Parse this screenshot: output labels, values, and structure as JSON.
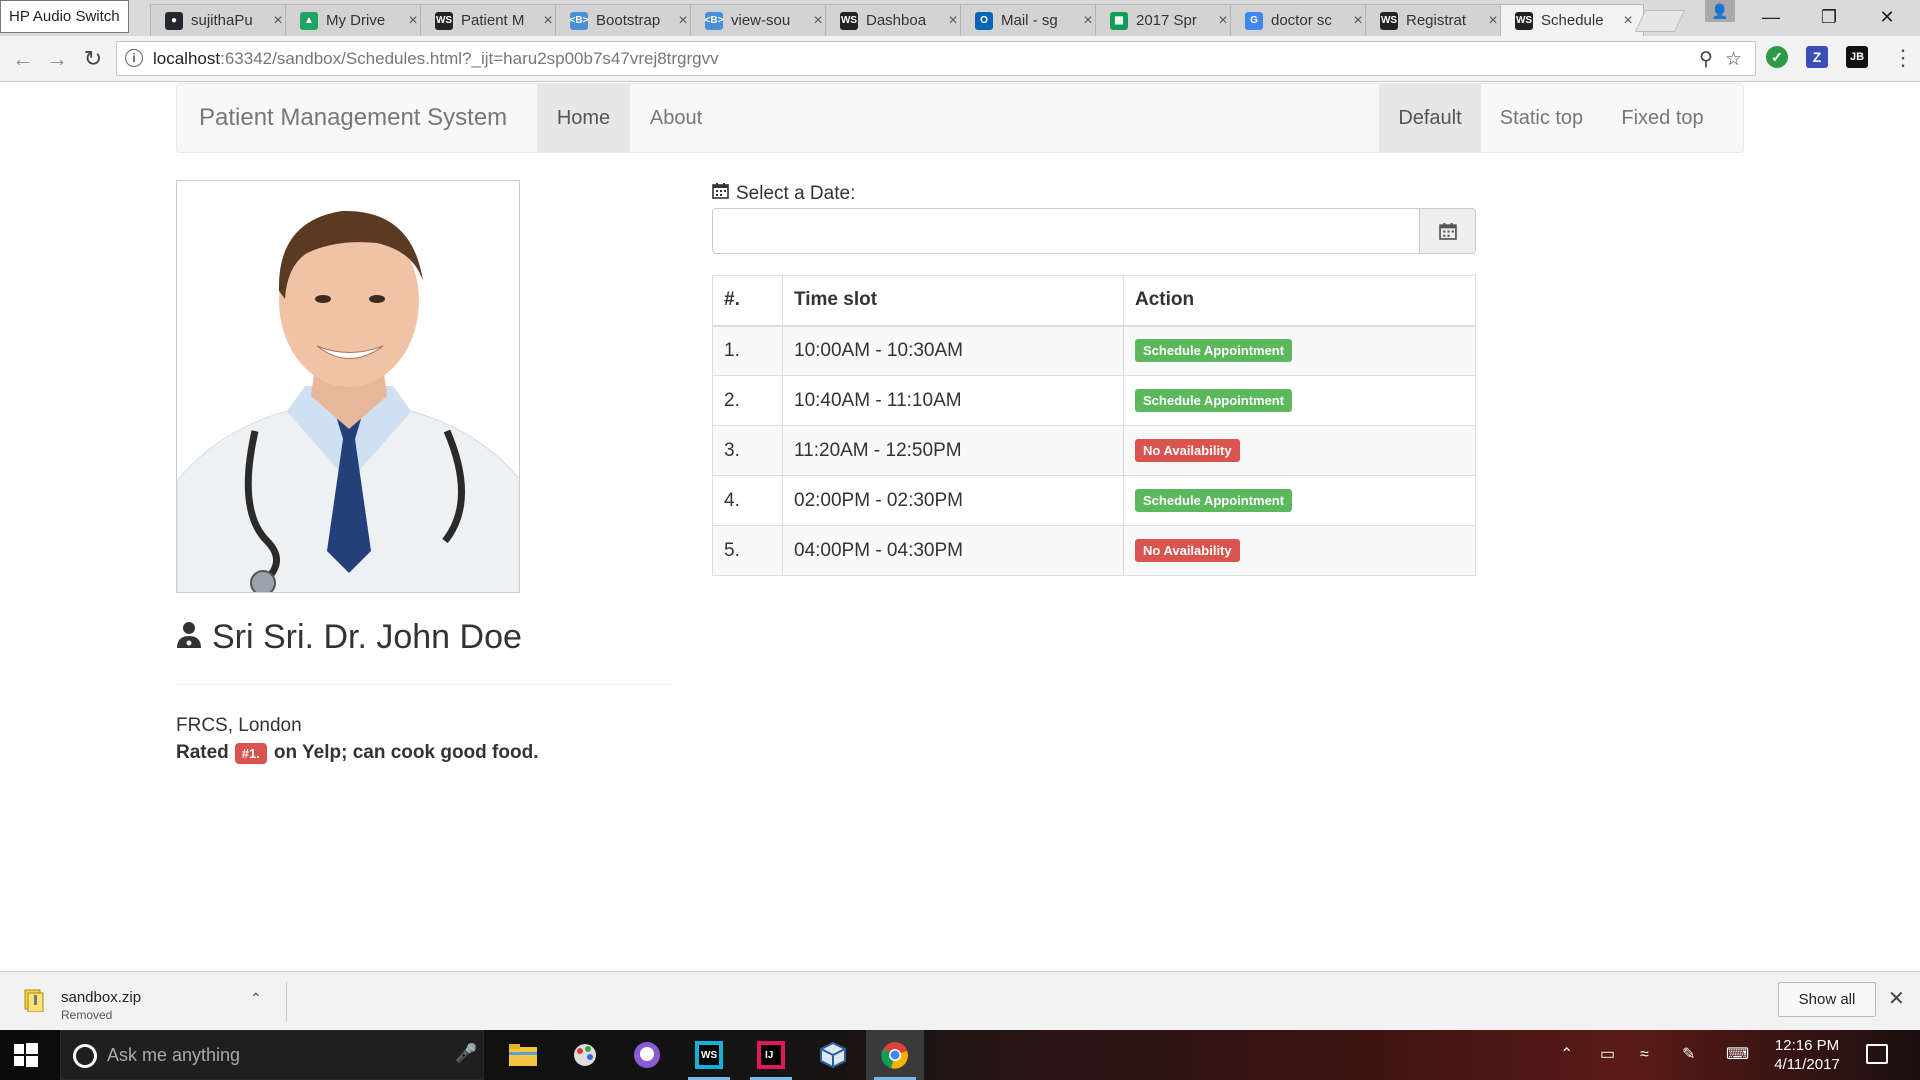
{
  "browser": {
    "tooltip": "HP Audio Switch",
    "tabs": [
      {
        "label": "sujithaPu",
        "icon": "github-icon"
      },
      {
        "label": "My Drive",
        "icon": "google-drive-icon"
      },
      {
        "label": "Patient M",
        "icon": "webstorm-icon"
      },
      {
        "label": "Bootstrap",
        "icon": "bootstrap-icon"
      },
      {
        "label": "view-sou",
        "icon": "bootstrap-icon"
      },
      {
        "label": "Dashboa",
        "icon": "webstorm-icon"
      },
      {
        "label": "Mail - sg",
        "icon": "outlook-icon"
      },
      {
        "label": "2017 Spr",
        "icon": "sheets-icon"
      },
      {
        "label": "doctor sc",
        "icon": "google-icon"
      },
      {
        "label": "Registrat",
        "icon": "webstorm-icon"
      },
      {
        "label": "Schedule",
        "icon": "webstorm-icon",
        "active": true
      }
    ],
    "url_host": "localhost",
    "url_rest": ":63342/sandbox/Schedules.html?_ijt=haru2sp00b7s47vrej8trgrgvv"
  },
  "navbar": {
    "brand": "Patient Management System",
    "left_links": [
      "Home",
      "About"
    ],
    "right_links": [
      "Default",
      "Static top",
      "Fixed top"
    ],
    "active_left": "Home",
    "active_right": "Default"
  },
  "doctor": {
    "name": "Sri Sri. Dr. John Doe",
    "qualification": "FRCS, London",
    "rated_prefix": "Rated",
    "rank_badge": "#1.",
    "rated_suffix": "on Yelp; can cook good food."
  },
  "schedule": {
    "date_label": "Select a Date:",
    "date_value": "",
    "columns": [
      "#.",
      "Time slot",
      "Action"
    ],
    "rows": [
      {
        "num": "1.",
        "slot": "10:00AM - 10:30AM",
        "action": "Schedule Appointment",
        "status": "success"
      },
      {
        "num": "2.",
        "slot": "10:40AM - 11:10AM",
        "action": "Schedule Appointment",
        "status": "success"
      },
      {
        "num": "3.",
        "slot": "11:20AM - 12:50PM",
        "action": "No Availability",
        "status": "danger"
      },
      {
        "num": "4.",
        "slot": "02:00PM - 02:30PM",
        "action": "Schedule Appointment",
        "status": "success"
      },
      {
        "num": "5.",
        "slot": "04:00PM - 04:30PM",
        "action": "No Availability",
        "status": "danger"
      }
    ]
  },
  "downloads": {
    "file_name": "sandbox.zip",
    "file_status": "Removed",
    "show_all": "Show all"
  },
  "taskbar": {
    "search_placeholder": "Ask me anything",
    "time": "12:16 PM",
    "date": "4/11/2017"
  },
  "colors": {
    "success": "#5cb85c",
    "danger": "#d9534f",
    "navbar_bg": "#f8f8f8"
  }
}
